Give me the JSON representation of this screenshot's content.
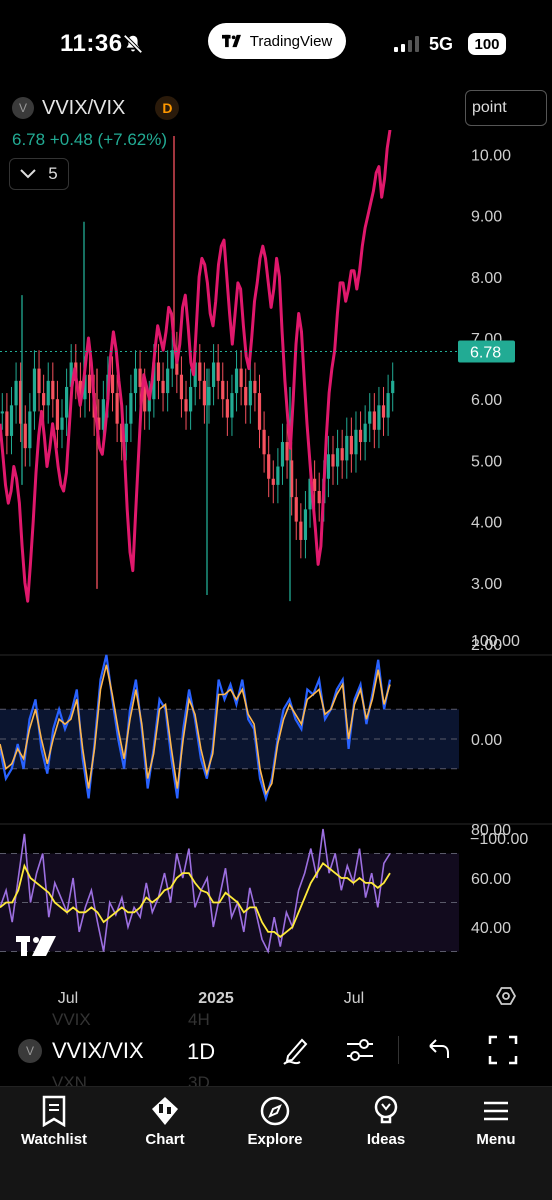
{
  "status_bar": {
    "time": "11:36",
    "network": "5G",
    "battery": "100",
    "pill_label": "TradingView"
  },
  "symbol": {
    "dot_letter": "V",
    "name": "VVIX/VIX",
    "badge": "D",
    "price_line": "6.78  +0.48 (+7.62%)",
    "collapsed_count": "5",
    "scale_mode": "point"
  },
  "colors": {
    "up": "#22ab94",
    "down": "#f7525f",
    "overlay": "#e0186c",
    "rsi_blue": "#2962ff",
    "rsi_orange": "#ffb74d",
    "stoch_purple": "#9c6fe0",
    "stoch_yellow": "#ffeb3b"
  },
  "chart_data": [
    {
      "type": "line",
      "panel": "price",
      "yticks": [
        "10.00",
        "9.00",
        "8.00",
        "7.00",
        "6.00",
        "5.00",
        "4.00",
        "3.00",
        "2.00"
      ],
      "ylim": [
        2.0,
        10.5
      ],
      "last_price_label": "6.78",
      "x_tick_labels": [
        "Jul",
        "2025",
        "Jul"
      ],
      "series": [
        {
          "values": [
            5.6,
            5.1,
            4.6,
            4.3,
            4.5,
            4.9,
            4.7,
            4.3,
            3.6,
            3.0,
            2.7,
            3.3,
            4.0,
            4.8,
            5.4,
            5.8,
            5.4,
            4.9,
            5.2,
            5.6,
            5.3,
            4.9,
            4.6,
            4.5,
            4.8,
            5.5,
            6.2,
            6.5,
            6.2,
            5.9,
            6.2,
            6.6,
            7.0,
            6.6,
            6.0,
            5.6,
            5.2,
            5.1,
            5.5,
            6.0,
            6.7,
            7.1,
            6.8,
            6.3,
            5.9,
            5.1,
            4.2,
            3.5,
            3.2,
            4.1,
            5.0,
            5.9,
            6.4,
            6.2,
            6.0,
            6.3,
            6.8,
            7.2,
            7.0,
            6.8,
            7.1,
            7.5,
            7.4,
            6.9,
            6.6,
            6.9,
            7.5,
            7.7,
            7.2,
            6.6,
            6.4,
            7.2,
            8.0,
            8.3,
            8.2,
            7.9,
            7.4,
            7.2,
            7.6,
            8.2,
            8.5,
            8.6,
            8.0,
            7.4,
            6.9,
            7.4,
            7.9,
            7.8,
            7.2,
            6.7,
            6.5,
            7.0,
            7.6,
            7.9,
            8.3,
            8.5,
            8.3,
            7.9,
            7.5,
            7.8,
            8.3,
            8.0,
            7.1,
            6.3,
            5.7,
            5.2,
            6.0,
            6.9,
            7.4,
            7.1,
            6.3,
            5.6,
            5.0,
            4.4,
            3.9,
            3.3,
            3.6,
            4.5,
            5.4,
            6.1,
            6.5,
            6.8,
            7.4,
            7.9,
            7.9,
            7.6,
            7.8,
            8.1,
            8.1,
            7.8,
            8.1,
            8.5,
            8.8,
            9.0,
            9.2,
            9.4,
            9.7,
            9.8,
            9.3,
            9.6,
            10.1,
            10.4
          ]
        },
        {
          "name": "candles",
          "values": [
            5.8,
            5.4,
            5.9,
            6.3,
            5.6,
            5.2,
            5.8,
            6.5,
            6.1,
            5.9,
            6.3,
            6.0,
            5.5,
            5.7,
            6.2,
            6.6,
            6.3,
            6.0,
            6.4,
            6.1,
            5.7,
            5.5,
            6.0,
            6.4,
            6.1,
            5.6,
            5.3,
            5.6,
            6.1,
            6.5,
            6.2,
            5.8,
            6.0,
            6.6,
            6.3,
            6.1,
            6.5,
            6.8,
            6.4,
            6.0,
            5.8,
            6.2,
            6.6,
            6.3,
            5.9,
            6.2,
            6.6,
            6.3,
            6.0,
            5.7,
            6.1,
            6.5,
            6.2,
            5.9,
            6.3,
            6.1,
            5.5,
            5.1,
            4.7,
            4.6,
            4.9,
            5.3,
            5.0,
            4.4,
            4.0,
            3.7,
            4.2,
            4.7,
            4.5,
            4.3,
            4.7,
            5.1,
            4.9,
            5.2,
            5.0,
            5.4,
            5.1,
            5.5,
            5.3,
            5.6,
            5.8,
            5.5,
            5.9,
            5.7,
            6.1,
            6.3
          ]
        }
      ]
    },
    {
      "type": "line",
      "panel": "oscillator",
      "yticks": [
        "100.00",
        "0.00",
        "−100.00"
      ],
      "ylim": [
        -100,
        100
      ],
      "series": [
        {
          "values": [
            -10,
            -40,
            -30,
            -5,
            -30,
            20,
            40,
            -10,
            -35,
            10,
            30,
            10,
            25,
            50,
            -20,
            -60,
            -5,
            60,
            85,
            40,
            0,
            -30,
            30,
            60,
            10,
            -50,
            -10,
            40,
            30,
            -20,
            -60,
            10,
            50,
            20,
            -20,
            -40,
            -10,
            60,
            40,
            55,
            35,
            60,
            20,
            10,
            -40,
            -60,
            -40,
            0,
            30,
            40,
            20,
            10,
            50,
            45,
            60,
            20,
            30,
            50,
            60,
            -10,
            40,
            55,
            15,
            45,
            80,
            30,
            60
          ]
        },
        {
          "values": [
            -5,
            -30,
            -25,
            -10,
            -20,
            10,
            30,
            0,
            -25,
            0,
            20,
            15,
            20,
            40,
            -10,
            -50,
            -10,
            50,
            75,
            45,
            10,
            -20,
            20,
            50,
            15,
            -40,
            -15,
            30,
            35,
            -10,
            -50,
            0,
            40,
            25,
            -10,
            -35,
            -15,
            45,
            45,
            50,
            40,
            50,
            25,
            15,
            -30,
            -55,
            -45,
            -5,
            20,
            35,
            25,
            15,
            40,
            45,
            50,
            25,
            30,
            45,
            55,
            0,
            35,
            50,
            20,
            40,
            70,
            35,
            55
          ]
        }
      ]
    },
    {
      "type": "line",
      "panel": "momentum",
      "yticks": [
        "80.00",
        "60.00",
        "40.00"
      ],
      "ylim": [
        25,
        80
      ],
      "series": [
        {
          "values": [
            48,
            55,
            42,
            60,
            78,
            50,
            62,
            70,
            44,
            58,
            52,
            46,
            60,
            38,
            48,
            55,
            42,
            30,
            50,
            45,
            52,
            40,
            48,
            44,
            58,
            46,
            52,
            62,
            50,
            70,
            60,
            72,
            48,
            55,
            60,
            40,
            52,
            64,
            44,
            50,
            38,
            56,
            46,
            35,
            30,
            44,
            32,
            46,
            40,
            55,
            62,
            72,
            60,
            80,
            62,
            70,
            55,
            65,
            58,
            72,
            52,
            62,
            48,
            66,
            70
          ]
        },
        {
          "values": [
            48,
            50,
            50,
            55,
            65,
            60,
            58,
            56,
            54,
            50,
            48,
            46,
            48,
            46,
            46,
            48,
            46,
            42,
            44,
            46,
            48,
            46,
            46,
            48,
            52,
            50,
            52,
            55,
            56,
            60,
            62,
            62,
            58,
            55,
            54,
            50,
            50,
            54,
            52,
            50,
            46,
            48,
            48,
            42,
            38,
            38,
            36,
            38,
            40,
            46,
            52,
            58,
            62,
            66,
            64,
            62,
            60,
            60,
            58,
            60,
            58,
            58,
            56,
            58,
            62
          ]
        }
      ]
    }
  ],
  "toolbar": {
    "symbol_letter": "V",
    "symbol": "VVIX/VIX",
    "interval": "1D",
    "ghost_prev_symbol": "VVIX",
    "ghost_prev_interval": "4H",
    "ghost_next_symbol": "VXN",
    "ghost_next_interval": "3D"
  },
  "tabs": [
    {
      "label": "Watchlist",
      "icon": "watchlist-icon"
    },
    {
      "label": "Chart",
      "icon": "candles-icon"
    },
    {
      "label": "Explore",
      "icon": "compass-icon"
    },
    {
      "label": "Ideas",
      "icon": "lightbulb-icon"
    },
    {
      "label": "Menu",
      "icon": "menu-icon"
    }
  ]
}
